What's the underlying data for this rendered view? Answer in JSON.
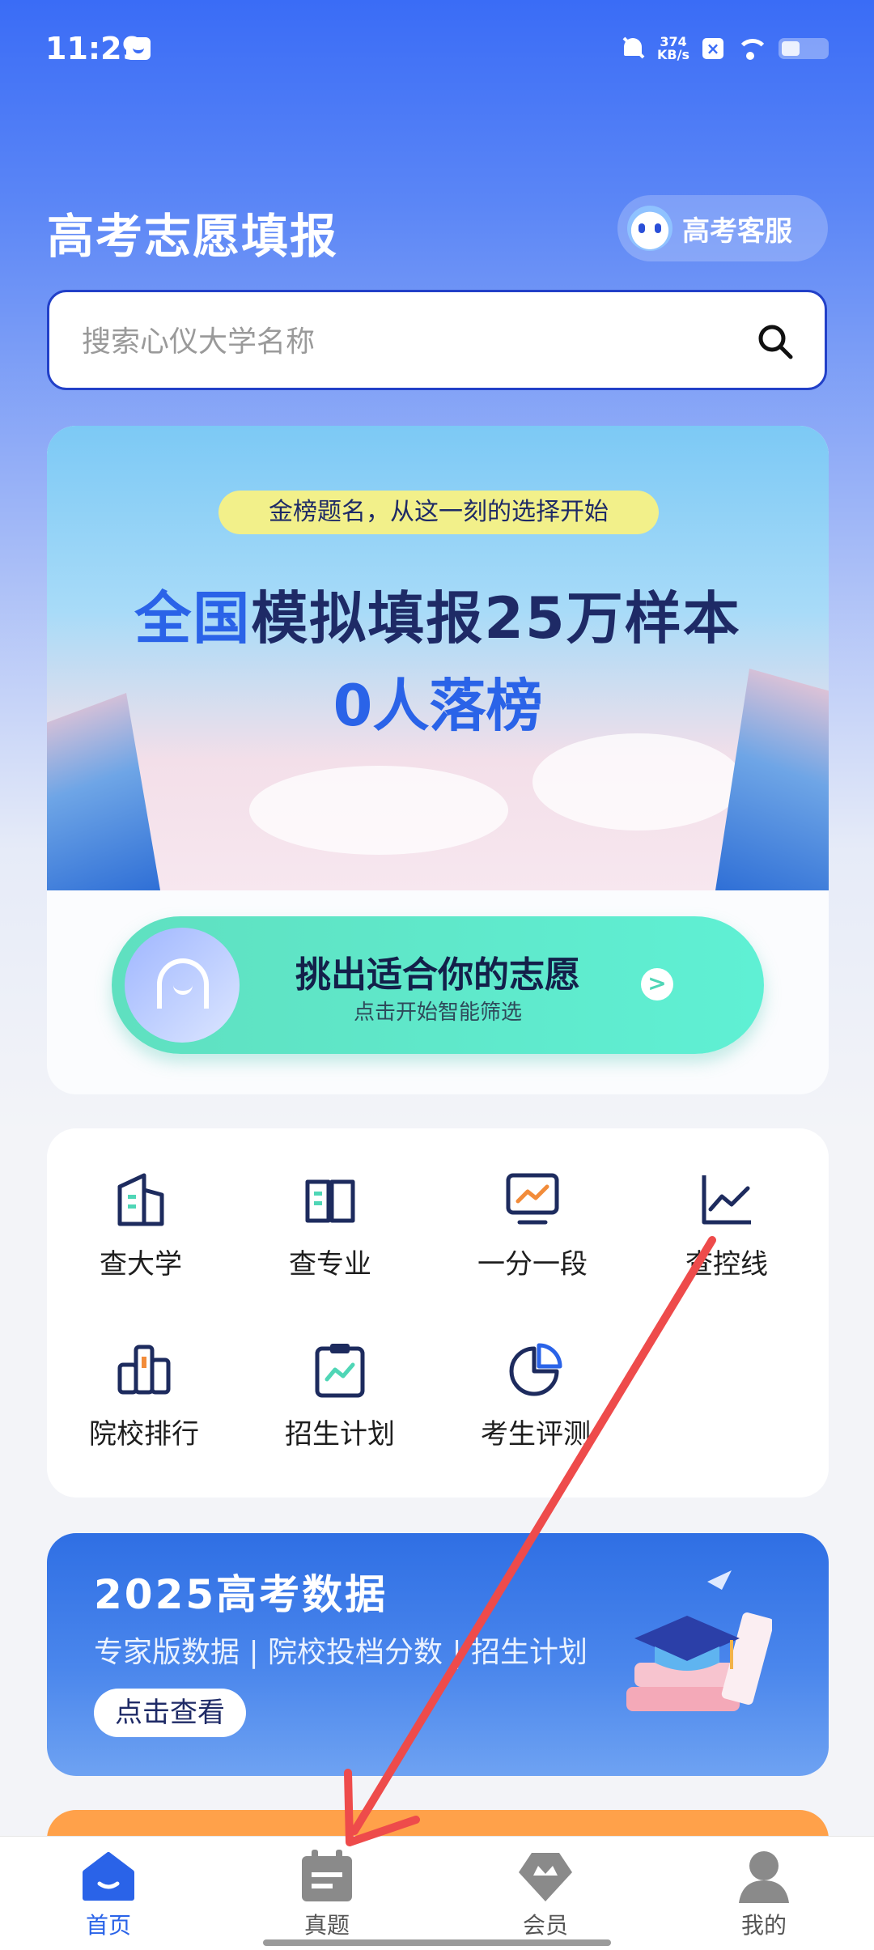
{
  "status_bar": {
    "time": "11:29",
    "net_speed_value": "374",
    "net_speed_unit": "KB/s",
    "icons": [
      "message-icon",
      "bell-muted-icon",
      "x-icon",
      "wifi-icon",
      "battery-icon"
    ]
  },
  "header": {
    "title": "高考志愿填报",
    "service_label": "高考客服"
  },
  "search": {
    "placeholder": "搜索心仪大学名称",
    "value": ""
  },
  "banner": {
    "tagline": "金榜题名，从这一刻的选择开始",
    "headline_highlight": "全国",
    "headline_rest": "模拟填报25万样本",
    "headline_line2": "0人落榜"
  },
  "cta": {
    "title": "挑出适合你的志愿",
    "subtitle": "点击开始智能筛选",
    "arrow": ">"
  },
  "features": [
    {
      "label": "查大学",
      "icon": "building-icon"
    },
    {
      "label": "查专业",
      "icon": "book-icon"
    },
    {
      "label": "一分一段",
      "icon": "monitor-chart-icon"
    },
    {
      "label": "查控线",
      "icon": "line-chart-icon"
    },
    {
      "label": "院校排行",
      "icon": "ranking-icon"
    },
    {
      "label": "招生计划",
      "icon": "clipboard-icon"
    },
    {
      "label": "考生评测",
      "icon": "pie-chart-icon"
    }
  ],
  "data_banner": {
    "title": "2025高考数据",
    "subtitle": "专家版数据 | 院校投档分数 | 招生计划",
    "button": "点击查看"
  },
  "bottom_nav": [
    {
      "label": "首页",
      "icon": "home-icon",
      "active": true
    },
    {
      "label": "真题",
      "icon": "calendar-icon",
      "active": false
    },
    {
      "label": "会员",
      "icon": "crown-icon",
      "active": false
    },
    {
      "label": "我的",
      "icon": "user-icon",
      "active": false
    }
  ],
  "colors": {
    "brand_blue": "#2a63e8",
    "cta_green": "#5fe0c0",
    "annotation_red": "#ee4b4b"
  }
}
